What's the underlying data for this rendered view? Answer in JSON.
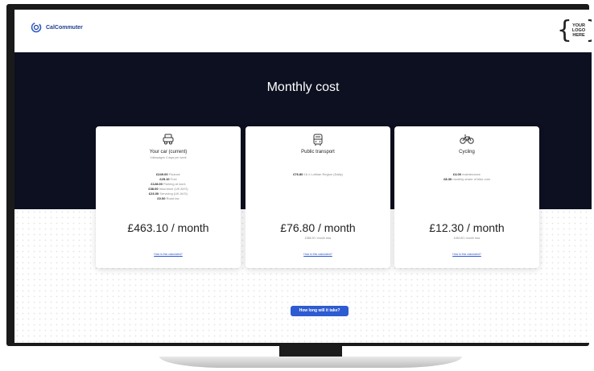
{
  "header": {
    "brand_name": "CalCommuter",
    "logo_text": [
      "YOUR",
      "LOGO",
      "HERE"
    ]
  },
  "hero": {
    "title": "Monthly cost"
  },
  "cards": [
    {
      "title": "Your car (current)",
      "subtitle": "Volkswagen 4 days per week",
      "lines": [
        {
          "amount": "£249.00",
          "label": "Finance"
        },
        {
          "amount": "£25.10",
          "label": "Fuel"
        },
        {
          "amount": "£128.00",
          "label": "Parking at work"
        },
        {
          "amount": "£38.00",
          "label": "Insurance (UK AVG)"
        },
        {
          "amount": "£23.00",
          "label": "Servicing (UK AVG)"
        },
        {
          "amount": "£0.00",
          "label": "Road tax"
        }
      ],
      "price": "£463.10 / month",
      "note": "",
      "link": "How is this calculated?",
      "icon": "car-icon"
    },
    {
      "title": "Public transport",
      "subtitle": "",
      "lines": [
        {
          "amount": "£76.80",
          "label": "16 x Lothian Region (Daily)"
        }
      ],
      "price": "£76.80 / month",
      "note": "£386.30 / month less",
      "link": "How is this calculated?",
      "icon": "bus-icon"
    },
    {
      "title": "Cycling",
      "subtitle": "",
      "lines": [
        {
          "amount": "£4.00",
          "label": "maintenance"
        },
        {
          "amount": "£8.30",
          "label": "monthly share of bike cost"
        }
      ],
      "price": "£12.30 / month",
      "note": "£450.80 / month less",
      "link": "How is this calculated?",
      "icon": "bicycle-icon"
    }
  ],
  "cta": {
    "label": "How long will it take?"
  },
  "colors": {
    "hero_bg": "#0c1020",
    "accent": "#2d5bd1",
    "brand": "#1f3f8f"
  }
}
